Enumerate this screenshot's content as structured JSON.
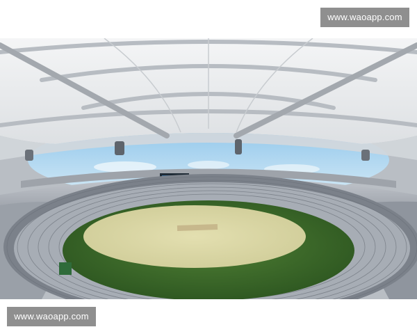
{
  "watermarks": {
    "top": "www.waoapp.com",
    "bottom": "www.waoapp.com"
  },
  "scene": {
    "subject": "stadium-interior-photo",
    "scoreboard_icon": "scoreboard-icon",
    "colors": {
      "canopy": "#eef0f1",
      "canopy_shadow": "#c9cdd1",
      "sky": "#a9d3ef",
      "seats": "#a6abb3",
      "seats_dark": "#6f757e",
      "outfield": "#3b6b2c",
      "infield": "#d9d6a5",
      "pitch": "#c7b88c"
    }
  }
}
